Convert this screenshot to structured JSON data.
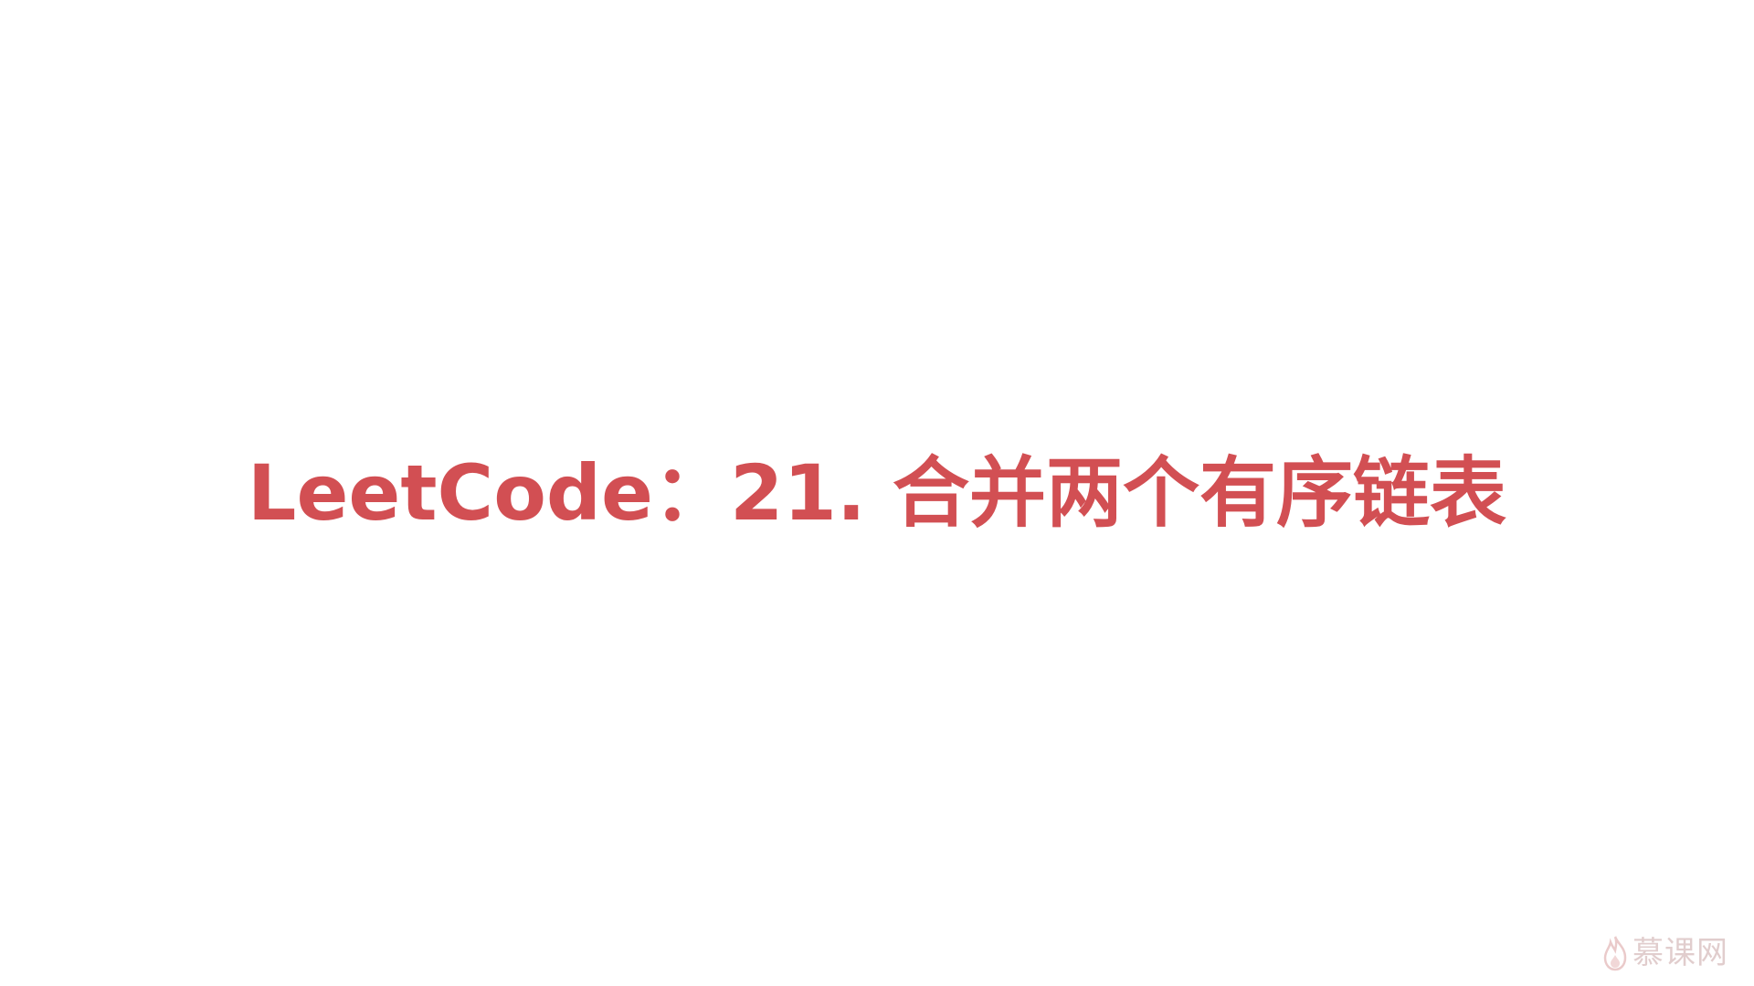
{
  "slide": {
    "title": "LeetCode：21. 合并两个有序链表",
    "title_color": "#d24f53"
  },
  "watermark": {
    "brand": "慕课网",
    "icon": "flame-icon",
    "color": "#c9a6a6"
  }
}
